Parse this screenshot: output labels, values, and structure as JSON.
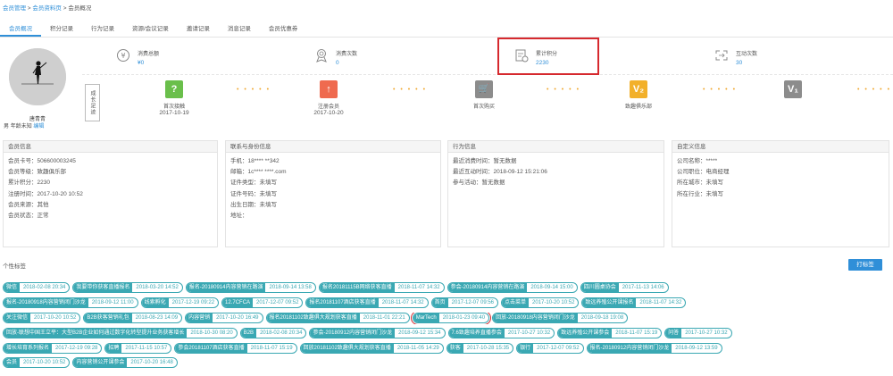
{
  "breadcrumb": {
    "a": "会员管理",
    "sep1": " > ",
    "b": "会员资料页",
    "sep2": " > ",
    "c": "会员概况"
  },
  "tabs": [
    "会员概况",
    "积分记录",
    "行为记录",
    "资源/会议记录",
    "邀请记录",
    "消息记录",
    "会员优惠券"
  ],
  "profile": {
    "name": "唐青青",
    "gender": "男",
    "age": "年龄未知",
    "edit": "编辑"
  },
  "stats": [
    {
      "label": "消费总额",
      "value": "¥0",
      "icon": "currency-icon"
    },
    {
      "label": "消费次数",
      "value": "0",
      "icon": "medal-icon"
    },
    {
      "label": "累计积分",
      "value": "2230",
      "icon": "points-icon"
    },
    {
      "label": "互动次数",
      "value": "30",
      "icon": "interaction-icon"
    }
  ],
  "growth_label": "成长足迹",
  "milestones": [
    {
      "label": "首次接触",
      "date": "2017-10-19",
      "color": "#6abf4b",
      "glyph": "?"
    },
    {
      "label": "注册会员",
      "date": "2017-10-20",
      "color": "#ef6a4f",
      "glyph": "↑"
    },
    {
      "label": "首次购买",
      "date": "",
      "color": "#8c8c8c",
      "glyph": "🛒"
    },
    {
      "label": "致趣俱乐部",
      "date": "",
      "color": "#f2b02a",
      "glyph": "V₂"
    },
    {
      "label": "",
      "date": "",
      "color": "#8c8c8c",
      "glyph": "V₁"
    }
  ],
  "dots": "• • • • •",
  "cards": [
    {
      "title": "会员信息",
      "rows": [
        "会员卡号：506600003245",
        "会员等级：致趣俱乐部",
        "累计积分：2230",
        "注册时间：2017-10-20 10:52",
        "会员来源：其他",
        "会员状态：正常"
      ]
    },
    {
      "title": "联系与身份信息",
      "rows": [
        "手机：18**** **342",
        "邮箱：1c**** ****.com",
        "证件类型：未填写",
        "证件号码：未填写",
        "出生日期：未填写",
        "地址："
      ]
    },
    {
      "title": "行为信息",
      "rows": [
        "最近消费时间：暂无数据",
        "最近互动时间：2018-09-12 15:21:06",
        "参与活动：暂无数据"
      ]
    },
    {
      "title": "自定义信息",
      "rows": [
        "公司名称：*****",
        "公司职位：电商经理",
        "所在城市：未填写",
        "所在行业：未填写"
      ]
    }
  ],
  "tags_title": "个性标签",
  "tag_button": "打标签",
  "tag_rows": [
    [
      [
        "微信",
        "2018-02-08 20:34"
      ],
      [
        "我要带你获客直播报名",
        "2018-03-20 14:52"
      ],
      [
        "报名-20180914内容营销在路演",
        "2018-09-14 13:58"
      ],
      [
        "报名20181115B网络获客直播",
        "2018-11-07 14:32"
      ],
      [
        "参会-20180914内容营销在路演",
        "2018-09-14 15:00"
      ],
      [
        "四川圆桌协会",
        "2017-11-13 14:06"
      ]
    ],
    [
      [
        "报名-20180918内容营销闭门沙龙",
        "2018-09-12 11:00"
      ],
      [
        "线索孵化",
        "2017-12-19 09:22"
      ],
      [
        "12.7CFCA",
        "2017-12-07 09:52"
      ],
      [
        "报名20181107酒店获客直播",
        "2018-11-07 14:32"
      ],
      [
        "首页",
        "2017-12-07 09:56"
      ],
      [
        "点击菜单",
        "2017-10-20 10:52"
      ],
      [
        "致远养殖公开课报名",
        "2018-11-07 14:32"
      ]
    ],
    [
      [
        "关注微信",
        "2017-10-20 10:52"
      ],
      [
        "B2B获客营销礼包",
        "2018-08-23 14:09"
      ],
      [
        "内容营销",
        "2017-10-20 16:49"
      ],
      [
        "报名20181102致趣俱大规划获客直播",
        "2018-11-01 22:21"
      ],
      [
        "MarTech",
        "2018-01-23 09:40"
      ],
      [
        "回放-20180918内容营销闭门沙龙",
        "2018-09-18 19:08"
      ]
    ],
    [
      [
        "回放-联想中国王立平：大型B2B企业如何通过数字化转型提升业务获客增长",
        "2018-10-30 08:20"
      ],
      [
        "B2B",
        "2018-02-08 20:34"
      ],
      [
        "参会-20180912内容营销闭门沙龙",
        "2018-09-12 15:34"
      ],
      [
        "7.6致趣培养直播参会",
        "2017-10-27 10:32"
      ],
      [
        "致远养殖公开课参会",
        "2018-11-07 15:19"
      ],
      [
        "问答",
        "2017-10-27 10:32"
      ]
    ],
    [
      [
        "增长培育系列报名",
        "2017-12-19 09:28"
      ],
      [
        "招聘",
        "2017-11-15 10:57"
      ],
      [
        "参会20181107酒店获客直播",
        "2018-11-07 15:19"
      ],
      [
        "回放20181102致趣俱大规划获客直播",
        "2018-11-05 14:29"
      ],
      [
        "获客",
        "2017-10-28 15:35"
      ],
      [
        "银行",
        "2017-12-07 09:52"
      ],
      [
        "报名-20180912内容营销闭门沙龙",
        "2018-09-12 13:59"
      ]
    ],
    [
      [
        "会员",
        "2017-10-20 10:52"
      ],
      [
        "内容营销公开课参会",
        "2017-10-20 16:48"
      ]
    ]
  ]
}
